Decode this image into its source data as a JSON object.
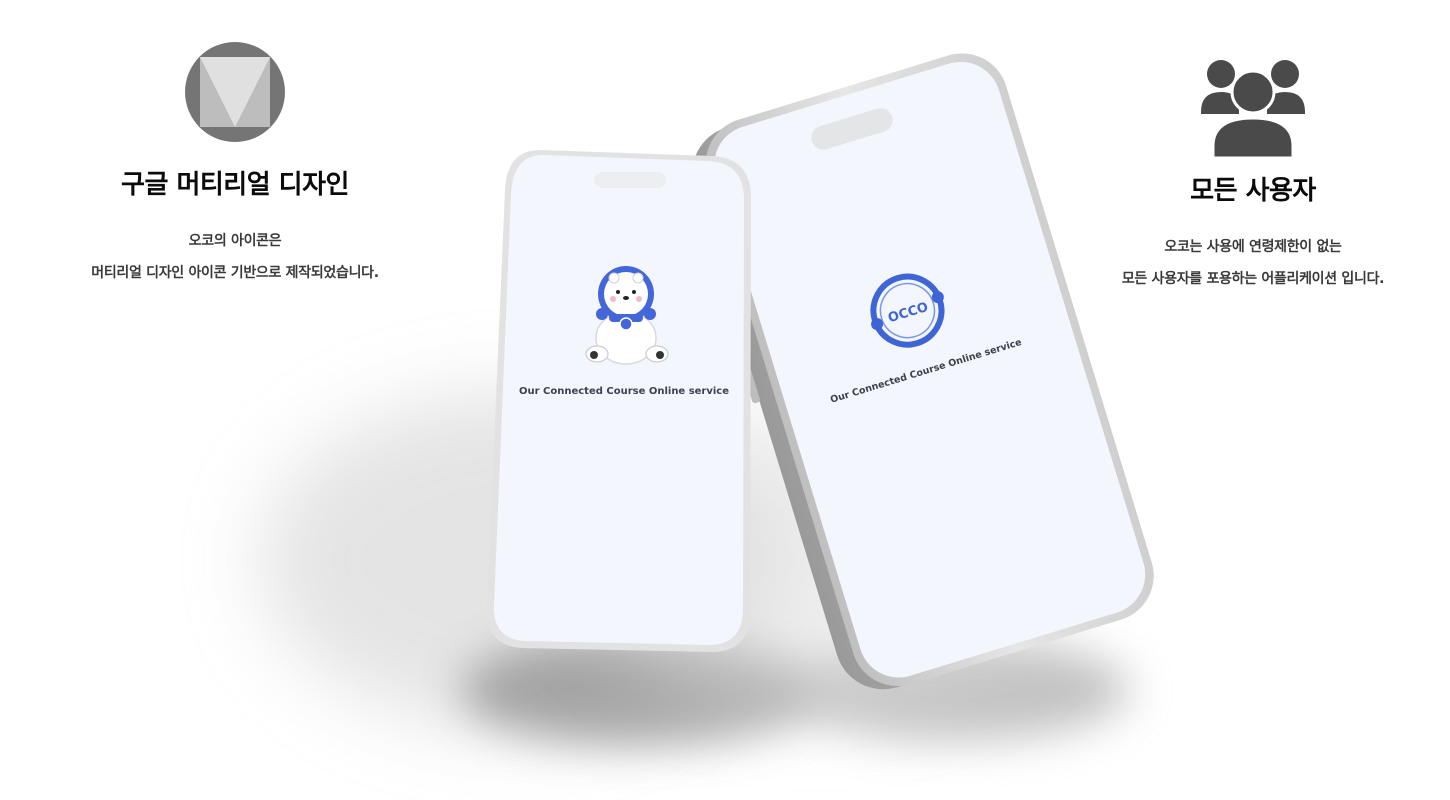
{
  "features": {
    "material": {
      "icon": "material-design-logo-icon",
      "title": "구글 머티리얼 디자인",
      "desc_line1": "오코의 아이콘은",
      "desc_line2": "머티리얼 디자인 아이콘 기반으로 제작되었습니다."
    },
    "users": {
      "icon": "users-group-icon",
      "title": "모든 사용자",
      "desc_line1": "오코는 사용에 연령제한이 없는",
      "desc_line2": "모든 사용자를 포용하는 어플리케이션 입니다."
    }
  },
  "phones": {
    "front": {
      "mascot_icon": "polar-bear-astronaut-icon",
      "tagline": "Our Connected Course Online service"
    },
    "back": {
      "logo_icon": "occo-ring-logo-icon",
      "logo_text": "OCCO",
      "tagline": "Our Connected Course Online service"
    }
  },
  "colors": {
    "screen": "#f3f6fc",
    "frame": "#d9d9d9",
    "brand_blue": "#3f64d6",
    "title": "#0b0b0b",
    "desc": "#3a3a3a",
    "icon_gray": "#4a4a4a"
  }
}
